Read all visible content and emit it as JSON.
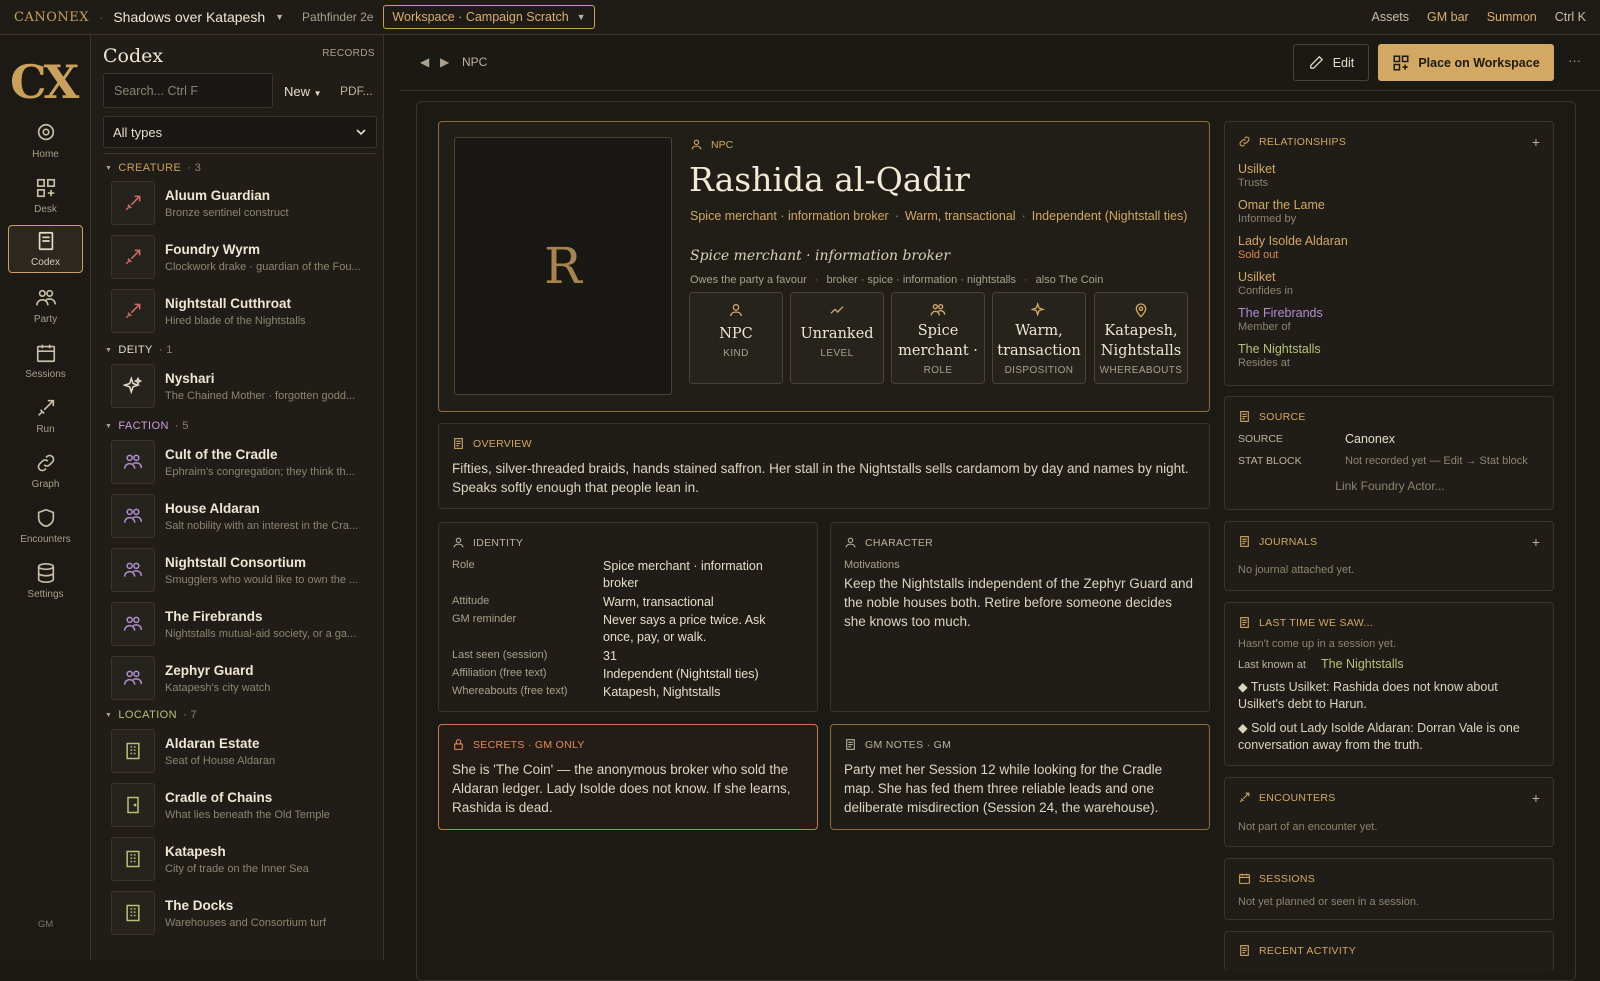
{
  "topbar": {
    "brand": "CANONEX",
    "campaign": "Shadows over Katapesh",
    "system": "Pathfinder 2e",
    "workspace": "Workspace · Campaign Scratch",
    "assets": "Assets",
    "gm_bar": "GM bar",
    "summon": "Summon",
    "summon_shortcut": "Ctrl K"
  },
  "rail": {
    "logo": "CX",
    "items": [
      {
        "label": "Home",
        "icon": "map-pin-icon"
      },
      {
        "label": "Desk",
        "icon": "grid-icon"
      },
      {
        "label": "Codex",
        "icon": "book-icon"
      },
      {
        "label": "Party",
        "icon": "users-icon"
      },
      {
        "label": "Sessions",
        "icon": "calendar-icon"
      },
      {
        "label": "Run",
        "icon": "sword-icon"
      },
      {
        "label": "Graph",
        "icon": "link-icon"
      },
      {
        "label": "Encounters",
        "icon": "shield-icon"
      },
      {
        "label": "Settings",
        "icon": "database-icon"
      }
    ],
    "gm_label": "GM"
  },
  "codex": {
    "title": "Codex",
    "records": "RECORDS",
    "search_placeholder": "Search...   Ctrl F",
    "new_label": "New",
    "pdf_label": "PDF...",
    "type_filter": "All types",
    "groups": [
      {
        "name": "CREATURE",
        "count": "3",
        "entries": [
          {
            "name": "Aluum Guardian",
            "desc": "Bronze sentinel construct"
          },
          {
            "name": "Foundry Wyrm",
            "desc": "Clockwork drake · guardian of the Fou..."
          },
          {
            "name": "Nightstall Cutthroat",
            "desc": "Hired blade of the Nightstalls"
          }
        ]
      },
      {
        "name": "DEITY",
        "count": "1",
        "entries": [
          {
            "name": "Nyshari",
            "desc": "The Chained Mother · forgotten godd..."
          }
        ]
      },
      {
        "name": "FACTION",
        "count": "5",
        "entries": [
          {
            "name": "Cult of the Cradle",
            "desc": "Ephraim's congregation; they think th..."
          },
          {
            "name": "House Aldaran",
            "desc": "Salt nobility with an interest in the Cra..."
          },
          {
            "name": "Nightstall Consortium",
            "desc": "Smugglers who would like to own the ..."
          },
          {
            "name": "The Firebrands",
            "desc": "Nightstalls mutual-aid society, or a ga..."
          },
          {
            "name": "Zephyr Guard",
            "desc": "Katapesh's city watch"
          }
        ]
      },
      {
        "name": "LOCATION",
        "count": "7",
        "entries": [
          {
            "name": "Aldaran Estate",
            "desc": "Seat of House Aldaran"
          },
          {
            "name": "Cradle of Chains",
            "desc": "What lies beneath the Old Temple"
          },
          {
            "name": "Katapesh",
            "desc": "City of trade on the Inner Sea"
          },
          {
            "name": "The Docks",
            "desc": "Warehouses and Consortium turf"
          }
        ]
      }
    ]
  },
  "header": {
    "breadcrumb": "NPC",
    "edit_label": "Edit",
    "place_label": "Place on Workspace",
    "more": "···"
  },
  "npc": {
    "portrait_letter": "R",
    "kind_label": "NPC",
    "name": "Rashida al-Qadir",
    "tags": [
      "Spice merchant · information broker",
      "Warm, transactional",
      "Independent (Nightstall ties)"
    ],
    "subtitle": "Spice merchant · information broker",
    "meta": [
      "Owes the party a favour",
      "broker · spice · information · nightstalls",
      "also The Coin"
    ],
    "stats": [
      {
        "value": "NPC",
        "label": "KIND"
      },
      {
        "value": "Unranked",
        "label": "LEVEL"
      },
      {
        "value": "Spice merchant ·",
        "label": "ROLE"
      },
      {
        "value": "Warm, transaction",
        "label": "DISPOSITION"
      },
      {
        "value": "Katapesh, Nightstalls",
        "label": "WHEREABOUTS"
      }
    ]
  },
  "overview": {
    "head": "OVERVIEW",
    "text": "Fifties, silver-threaded braids, hands stained saffron. Her stall in the Nightstalls sells cardamom by day and names by night. Speaks softly enough that people lean in."
  },
  "identity": {
    "head": "IDENTITY",
    "rows": [
      {
        "k": "Role",
        "v": "Spice merchant · information broker"
      },
      {
        "k": "Attitude",
        "v": "Warm, transactional"
      },
      {
        "k": "GM reminder",
        "v": "Never says a price twice. Ask once, pay, or walk."
      },
      {
        "k": "Last seen (session)",
        "v": "31"
      },
      {
        "k": "Affiliation (free text)",
        "v": "Independent (Nightstall ties)"
      },
      {
        "k": "Whereabouts (free text)",
        "v": "Katapesh, Nightstalls"
      }
    ]
  },
  "character": {
    "head": "CHARACTER",
    "label": "Motivations",
    "text": "Keep the Nightstalls independent of the Zephyr Guard and the noble houses both. Retire before someone decides she knows too much."
  },
  "secrets": {
    "head": "SECRETS · GM ONLY",
    "text": "She is 'The Coin' — the anonymous broker who sold the Aldaran ledger. Lady Isolde does not know. If she learns, Rashida is dead."
  },
  "gmnotes": {
    "head": "GM NOTES · GM",
    "text": "Party met her Session 12 while looking for the Cradle map. She has fed them three reliable leads and one deliberate misdirection (Session 24, the warehouse)."
  },
  "relationships": {
    "head": "RELATIONSHIPS",
    "add": "+",
    "items": [
      {
        "name": "Usilket",
        "sub": "Trusts",
        "color": "#d2a862",
        "subcolor": "#8c8470"
      },
      {
        "name": "Omar the Lame",
        "sub": "Informed by",
        "color": "#d2a862",
        "subcolor": "#8c8470"
      },
      {
        "name": "Lady Isolde Aldaran",
        "sub": "Sold out",
        "color": "#d2a862",
        "subcolor": "#d98a4a"
      },
      {
        "name": "Usilket",
        "sub": "Confides in",
        "color": "#d2a862",
        "subcolor": "#8c8470"
      },
      {
        "name": "The Firebrands",
        "sub": "Member of",
        "color": "#b08ed0",
        "subcolor": "#8c8470"
      },
      {
        "name": "The Nightstalls",
        "sub": "Resides at",
        "color": "#b5c276",
        "subcolor": "#8c8470"
      }
    ]
  },
  "source": {
    "head": "SOURCE",
    "rows": [
      {
        "k": "SOURCE",
        "v": "Canonex"
      },
      {
        "k": "STAT BLOCK",
        "v": "Not recorded yet — Edit → Stat block"
      }
    ],
    "link": "Link Foundry Actor..."
  },
  "journals": {
    "head": "JOURNALS",
    "add": "+",
    "empty": "No journal attached yet."
  },
  "lasttime": {
    "head": "LAST TIME WE SAW...",
    "empty": "Hasn't come up in a session yet.",
    "last_known_label": "Last known at",
    "last_known": "The Nightstalls",
    "notes": [
      "◆ Trusts Usilket: Rashida does not know about Usilket's debt to Harun.",
      "◆ Sold out Lady Isolde Aldaran: Dorran Vale is one conversation away from the truth."
    ]
  },
  "encounters": {
    "head": "ENCOUNTERS",
    "add": "+",
    "empty": "Not part of an encounter yet."
  },
  "sessions": {
    "head": "SESSIONS",
    "empty": "Not yet planned or seen in a session."
  },
  "recent": {
    "head": "RECENT ACTIVITY"
  },
  "colors": {
    "accent": "#d2a862",
    "creature": "#d36a6a",
    "faction": "#b08ed0",
    "location": "#b5c276"
  }
}
